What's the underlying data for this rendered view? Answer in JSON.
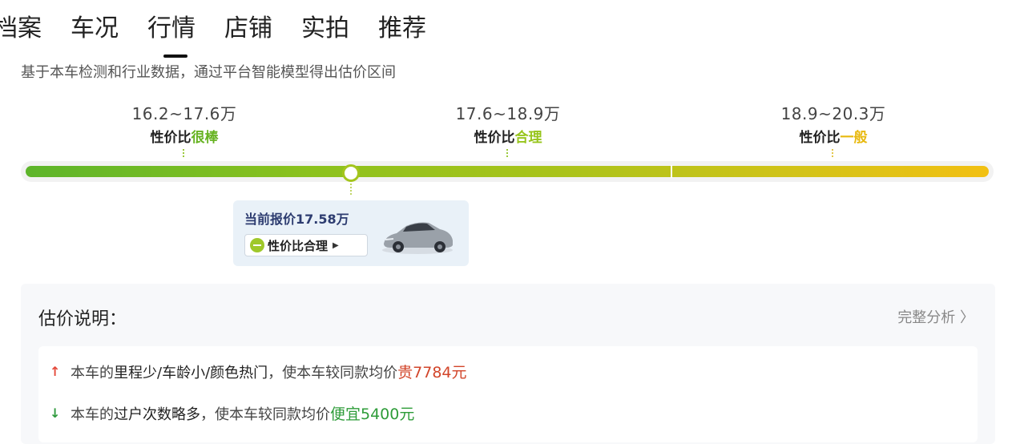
{
  "tabs": [
    {
      "label": "档案"
    },
    {
      "label": "车况"
    },
    {
      "label": "行情",
      "active": true
    },
    {
      "label": "店铺"
    },
    {
      "label": "实拍"
    },
    {
      "label": "推荐"
    }
  ],
  "subtitle": "基于本车检测和行业数据，通过平台智能模型得出估价区间",
  "ranges": [
    {
      "price": "16.2~17.6万",
      "label_prefix": "性价比",
      "label_tag": "很棒",
      "tag_color": "#67b322"
    },
    {
      "price": "17.6~18.9万",
      "label_prefix": "性价比",
      "label_tag": "合理",
      "tag_color": "#97c51c"
    },
    {
      "price": "18.9~20.3万",
      "label_prefix": "性价比",
      "label_tag": "一般",
      "tag_color": "#e8b90f"
    }
  ],
  "current_quote": {
    "title": "当前报价17.58万",
    "verdict": "性价比合理",
    "position_fraction": 0.335
  },
  "explanation": {
    "title": "估价说明：",
    "link": "完整分析 ",
    "link_chevron": "〉",
    "reasons": [
      {
        "direction": "up",
        "prefix": "本车的",
        "emphasis": "里程少/车龄小/颜色热门",
        "middle": "，使本车较同款均价",
        "result": "贵7784元"
      },
      {
        "direction": "down",
        "prefix": "本车的",
        "emphasis": "过户次数略多",
        "middle": "，使本车较同款均价",
        "result": "便宜5400元"
      }
    ]
  },
  "colors": {
    "accent_green": "#67b322",
    "accent_red": "#d2452a",
    "accent_yellow": "#e8b90f"
  }
}
